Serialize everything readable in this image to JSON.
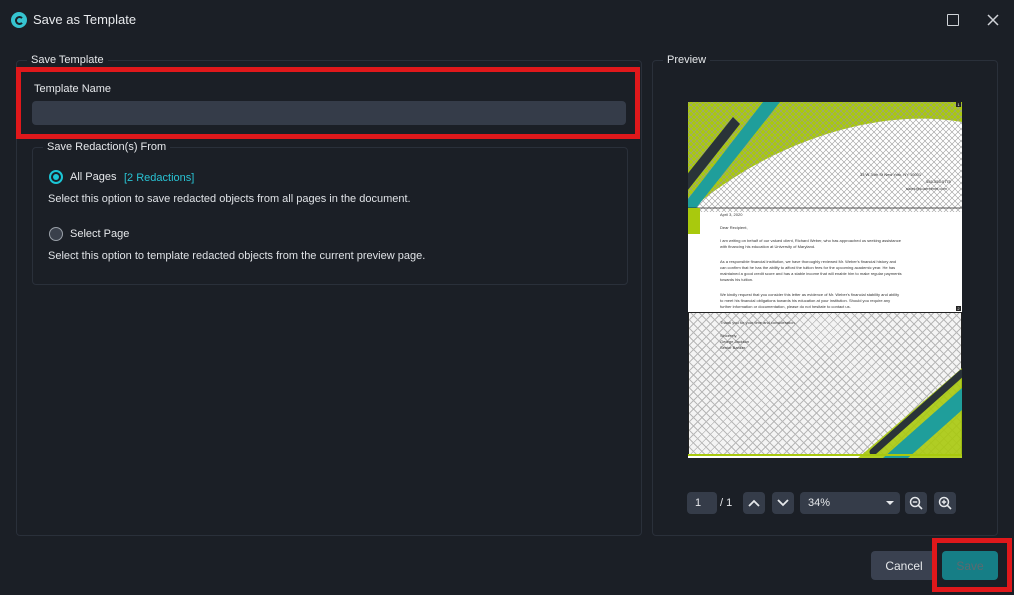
{
  "window": {
    "title": "Save as Template",
    "logo_icon": "app-logo-icon",
    "controls": [
      "maximize-icon",
      "close-icon"
    ]
  },
  "left_panel": {
    "group_title": "Save Template",
    "template_name_label": "Template Name",
    "template_name_value": "",
    "redaction_group_title": "Save Redaction(s) From",
    "options": [
      {
        "label": "All Pages",
        "count": "[2 Redactions]",
        "description": "Select this option to save redacted objects from all pages in the document.",
        "selected": true
      },
      {
        "label": "Select Page",
        "description": "Select this option to template redacted objects from the current preview page.",
        "selected": false
      }
    ]
  },
  "preview": {
    "group_title": "Preview",
    "page_content": {
      "address": "33 W 34th St New York, NY 10001",
      "phone": "555-555-5775",
      "email": "sales@soarrelmet.com",
      "date": "April 3, 2020",
      "salutation": "Dear Recipient,",
      "para1": [
        "I am writing on behalf of our valued client, Richard Weber, who has approached us seeking assistance",
        "with financing his education at University of Maryland."
      ],
      "para2": [
        "As a responsible financial institution, we have thoroughly reviewed Mr. Weber's financial history and",
        "can confirm that he has the ability to afford the tuition fees for the upcoming academic year. He has",
        "maintained a good credit score and has a stable income that will enable him to make regular payments",
        "towards his tuition."
      ],
      "para3": [
        "We kindly request that you consider this letter as evidence of Mr. Weber's financial stability and ability",
        "to meet his financial obligations towards his education at your institution. Should you require any",
        "further information or documentation, please do not hesitate to contact us."
      ],
      "closing": "Thank you for your time and consideration.",
      "signoff": [
        "Sincerely,",
        "George Jackson",
        "Senior Banker"
      ],
      "badges": [
        "1",
        "2"
      ]
    },
    "page_number": "1",
    "page_total": "/ 1",
    "zoom": "34%",
    "nav_icons": [
      "chevron-up-icon",
      "chevron-down-icon",
      "zoom-out-icon",
      "zoom-in-icon"
    ]
  },
  "footer": {
    "cancel_label": "Cancel",
    "save_label": "Save"
  },
  "colors": {
    "background": "#1b1f26",
    "accent": "#1bc6d6",
    "highlight": "#e0181b",
    "save_button": "#167e86",
    "input": "#353c49"
  }
}
